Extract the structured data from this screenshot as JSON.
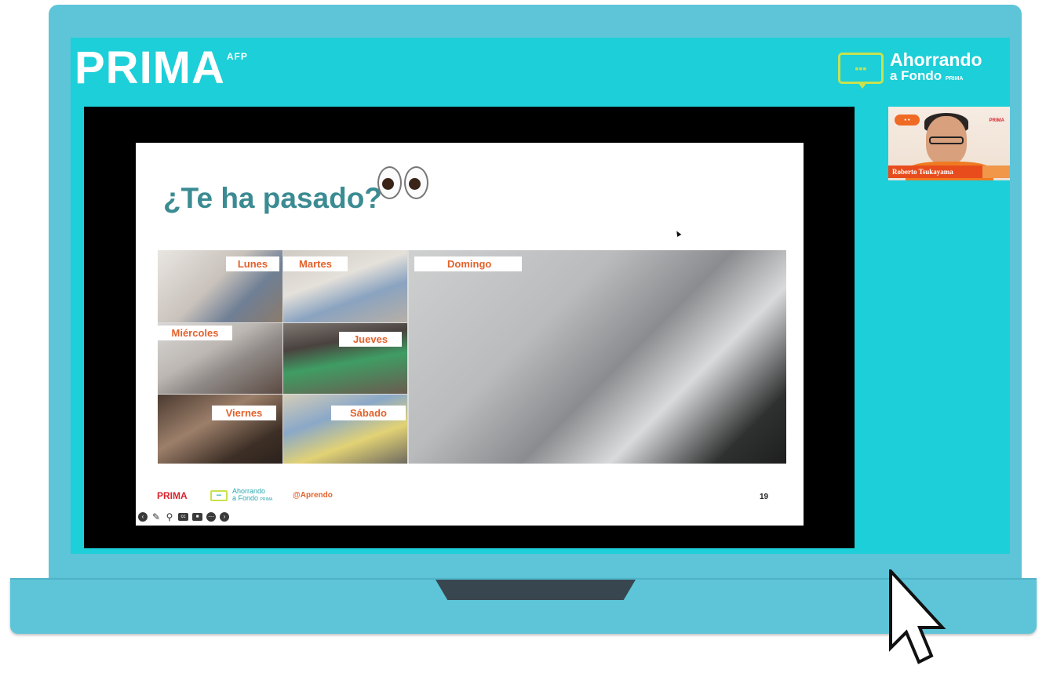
{
  "brand": {
    "name": "PRIMA",
    "sup": "AFP"
  },
  "program_logo": {
    "line1": "Ahorrando",
    "line2": "a Fondo",
    "tag": "PRIMA"
  },
  "slide": {
    "title": "¿Te ha pasado?",
    "day_labels": [
      "Lunes",
      "Martes",
      "Miércoles",
      "Jueves",
      "Viernes",
      "Sábado",
      "Domingo"
    ],
    "footer": {
      "brand": "PRIMA",
      "program_line1": "Ahorrando",
      "program_line2": "a Fondo",
      "program_tag": "PRIMA",
      "aprendo": "Aprendo"
    },
    "page_number": "19"
  },
  "webcam": {
    "participant_name": "Roberto Tsukayama",
    "corner_brand": "PRIMA"
  },
  "toolbar": {
    "icons": [
      "back-icon",
      "pen-icon",
      "zoom-icon",
      "captions-icon",
      "camera-icon",
      "more-icon",
      "forward-icon"
    ]
  },
  "colors": {
    "screen": "#1ccfd8",
    "laptop": "#5ec5d9",
    "title": "#3b8b92",
    "accent": "#e2622c",
    "brand_red": "#d9232d",
    "lime": "#c9e24d"
  }
}
